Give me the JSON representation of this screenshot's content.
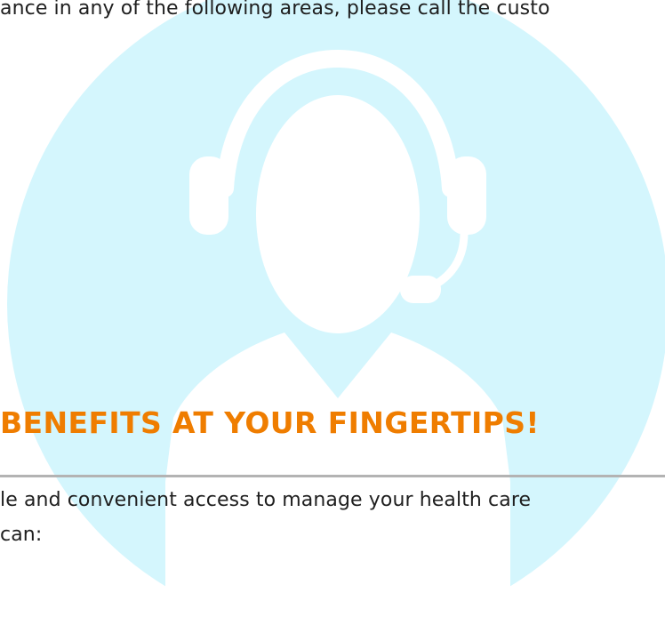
{
  "intro": {
    "text": "ance in any of the following areas, please call the custo"
  },
  "section": {
    "headline": "BENEFITS AT YOUR FINGERTIPS!",
    "body_lines": [
      "le and convenient access to manage your health care",
      "can:"
    ]
  },
  "illustration": {
    "icon": "customer-support-headset-icon",
    "circle_color": "#d4f6fd",
    "figure_color": "#ffffff"
  },
  "colors": {
    "accent": "#ef7d00",
    "text": "#1f1f1f",
    "divider": "#b3b3b3"
  }
}
